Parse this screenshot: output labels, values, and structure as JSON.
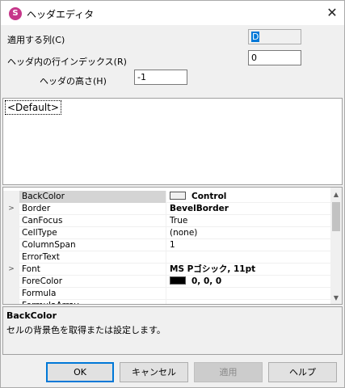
{
  "window": {
    "title": "ヘッダエディタ",
    "app_icon_glyph": "S",
    "close_glyph": "✕",
    "accent_color": "#0078d7",
    "icon_color": "#c6368a"
  },
  "form": {
    "apply_column_label": "適用する列(C)",
    "apply_column_value": "D",
    "row_index_label": "ヘッダ内の行インデックス(R)",
    "row_index_value": "0",
    "height_label": "ヘッダの高さ(H)",
    "height_value": "-1"
  },
  "header_list": {
    "items": [
      "<Default>"
    ]
  },
  "property_grid": {
    "rows": [
      {
        "name": "BackColor",
        "value": "Control",
        "expand": false,
        "bold": true,
        "swatch": "#f0f0f0",
        "selected": true
      },
      {
        "name": "Border",
        "value": "BevelBorder",
        "expand": true,
        "bold": true
      },
      {
        "name": "CanFocus",
        "value": "True",
        "expand": false
      },
      {
        "name": "CellType",
        "value": "(none)",
        "expand": false
      },
      {
        "name": "ColumnSpan",
        "value": "1",
        "expand": false
      },
      {
        "name": "ErrorText",
        "value": "",
        "expand": false
      },
      {
        "name": "Font",
        "value": "MS Pゴシック, 11pt",
        "expand": true,
        "bold": true
      },
      {
        "name": "ForeColor",
        "value": "0, 0, 0",
        "expand": false,
        "bold": true,
        "swatch": "#000000"
      },
      {
        "name": "Formula",
        "value": "",
        "expand": false
      },
      {
        "name": "FormulaArray",
        "value": "",
        "expand": false
      }
    ],
    "expand_glyph": ">",
    "scroll_up_glyph": "▲",
    "scroll_down_glyph": "▼"
  },
  "description": {
    "title": "BackColor",
    "text": "セルの背景色を取得または設定します。"
  },
  "buttons": {
    "ok": "OK",
    "cancel": "キャンセル",
    "apply": "適用",
    "help": "ヘルプ"
  }
}
